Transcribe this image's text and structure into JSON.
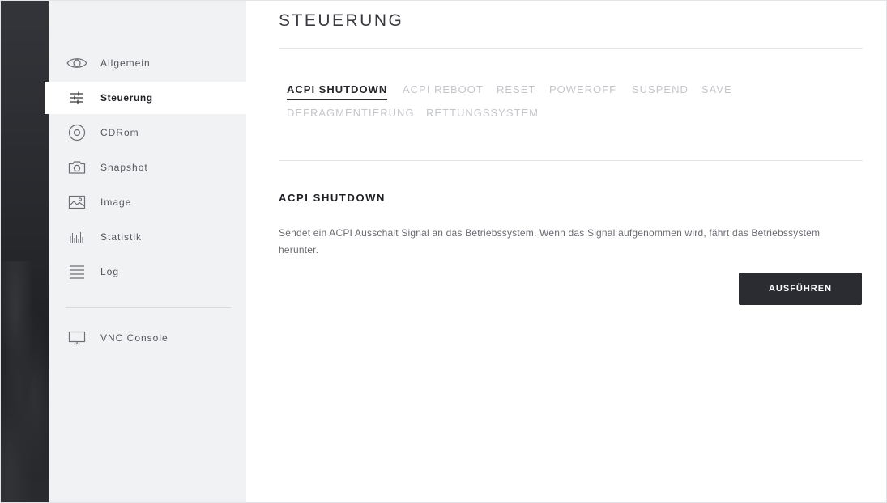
{
  "sidebar": {
    "items": [
      {
        "label": "Allgemein",
        "icon": "eye-icon"
      },
      {
        "label": "Steuerung",
        "icon": "sliders-icon",
        "active": true
      },
      {
        "label": "CDRom",
        "icon": "disc-icon"
      },
      {
        "label": "Snapshot",
        "icon": "camera-icon"
      },
      {
        "label": "Image",
        "icon": "image-icon"
      },
      {
        "label": "Statistik",
        "icon": "bar-chart-icon"
      },
      {
        "label": "Log",
        "icon": "list-icon"
      }
    ],
    "vnc": {
      "label": "VNC Console",
      "icon": "monitor-icon"
    }
  },
  "main": {
    "title": "STEUERUNG",
    "tabs": [
      {
        "label": "ACPI SHUTDOWN",
        "active": true
      },
      {
        "label": "ACPI REBOOT"
      },
      {
        "label": "RESET"
      },
      {
        "label": "POWEROFF"
      },
      {
        "label": "SUSPEND"
      },
      {
        "label": "SAVE"
      },
      {
        "label": "DEFRAGMENTIERUNG"
      },
      {
        "label": "RETTUNGSSYSTEM"
      }
    ],
    "section_title": "ACPI SHUTDOWN",
    "description": "Sendet ein ACPI Ausschalt Signal an das Betriebssystem. Wenn das Signal aufgenommen wird, fährt das Betriebssystem herunter.",
    "button_label": "AUSFÜHREN"
  },
  "colors": {
    "sidebar_bg": "#f1f2f4",
    "button_bg": "#2b2c31",
    "tab_inactive": "#c4c6cb",
    "text_dark": "#1e1f23"
  }
}
